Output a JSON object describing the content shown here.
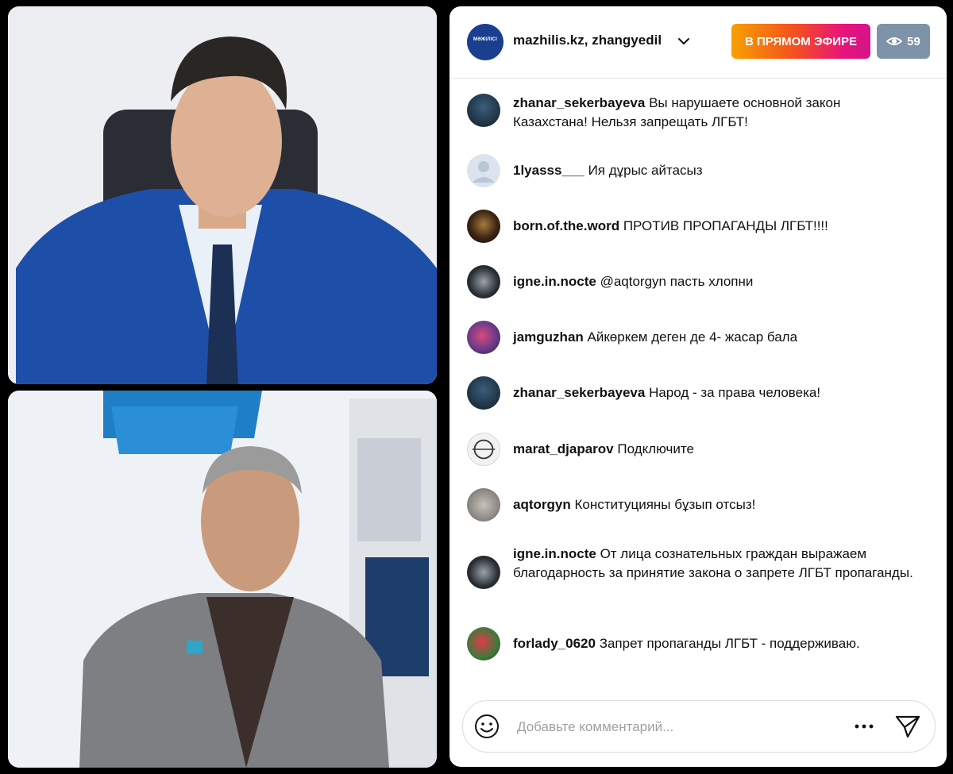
{
  "header": {
    "channel_name": "mazhilis.kz, zhangyedil",
    "avatar_text": "МӘЖІЛІСІ",
    "live_label": "В ПРЯМОМ ЭФИРЕ",
    "viewer_count": "59",
    "live_gradient": [
      "#f8a000",
      "#f4511e",
      "#e8147a"
    ]
  },
  "comments": [
    {
      "user": "zhanar_sekerbayeva",
      "text": "Вы нарушаете основной закон Казахстана! Нельзя запрещать ЛГБТ!"
    },
    {
      "user": "1lyasss___",
      "text": "Ия дұрыс айтасыз"
    },
    {
      "user": "born.of.the.word",
      "text": "ПРОТИВ ПРОПАГАНДЫ ЛГБТ!!!!"
    },
    {
      "user": "igne.in.nocte",
      "text": "@aqtorgyn пасть хлопни"
    },
    {
      "user": "jamguzhan",
      "text": "Айкөркем деген де 4- жасар бала"
    },
    {
      "user": "zhanar_sekerbayeva",
      "text": "Народ - за права человека!"
    },
    {
      "user": "marat_djaparov",
      "text": "Подключите"
    },
    {
      "user": "aqtorgyn",
      "text": "Конституцияны бұзып отсыз!"
    },
    {
      "user": "igne.in.nocte",
      "text": "От лица сознательных граждан выражаем благодарность за принятие закона о запрете ЛГБТ пропаганды."
    },
    {
      "user": "forlady_0620",
      "text": "Запрет пропаганды ЛГБТ - поддерживаю."
    }
  ],
  "comment_bar": {
    "placeholder": "Добавьте комментарий...",
    "emoji_icon": "smiley-icon",
    "more_icon": "more-dots-icon",
    "send_icon": "paper-plane-icon"
  }
}
